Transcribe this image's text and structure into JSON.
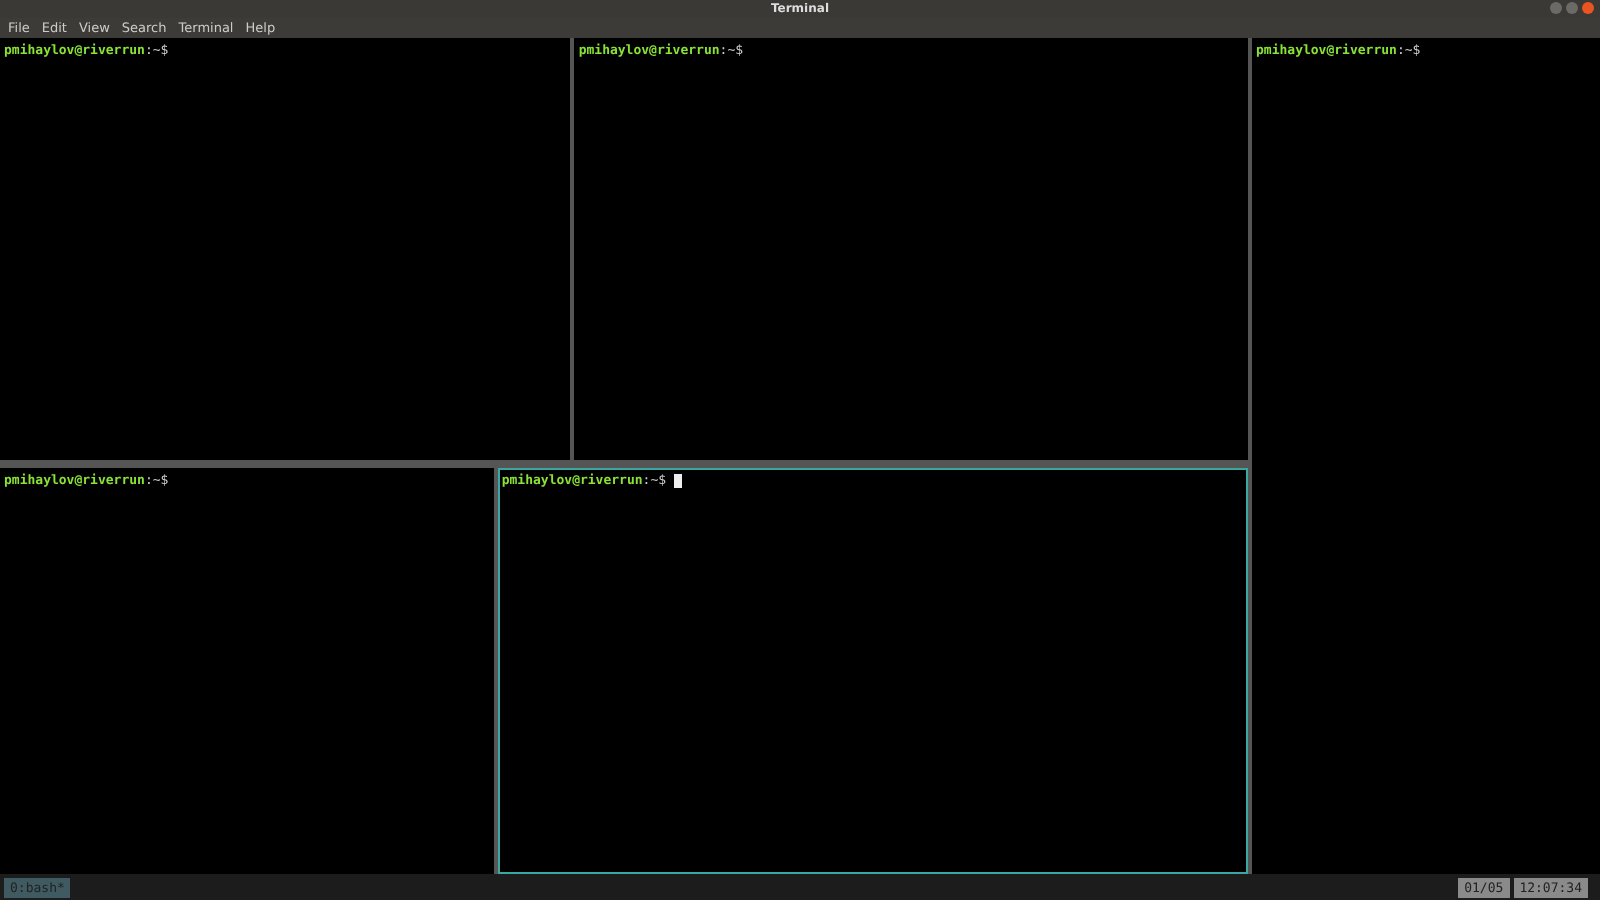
{
  "window": {
    "title": "Terminal"
  },
  "menu": [
    "File",
    "Edit",
    "View",
    "Search",
    "Terminal",
    "Help"
  ],
  "columns": [
    {
      "rows": [
        {
          "panes": [
            {
              "user": "pmihaylov@riverrun",
              "path": ":~$",
              "active": false
            },
            {
              "user": "pmihaylov@riverrun",
              "path": ":~$",
              "active": false
            }
          ]
        },
        {
          "panes": [
            {
              "user": "pmihaylov@riverrun",
              "path": ":~$",
              "active": false
            },
            {
              "user": "pmihaylov@riverrun",
              "path": ":~$",
              "active": true
            }
          ]
        }
      ]
    },
    {
      "rows": [
        {
          "panes": [
            {
              "user": "pmihaylov@riverrun",
              "path": ":~$",
              "active": false
            }
          ]
        }
      ]
    }
  ],
  "status_bar": {
    "windows": [
      {
        "label": "0:bash*",
        "selected": true
      }
    ],
    "position": "01/05",
    "time": "12:07:34"
  }
}
